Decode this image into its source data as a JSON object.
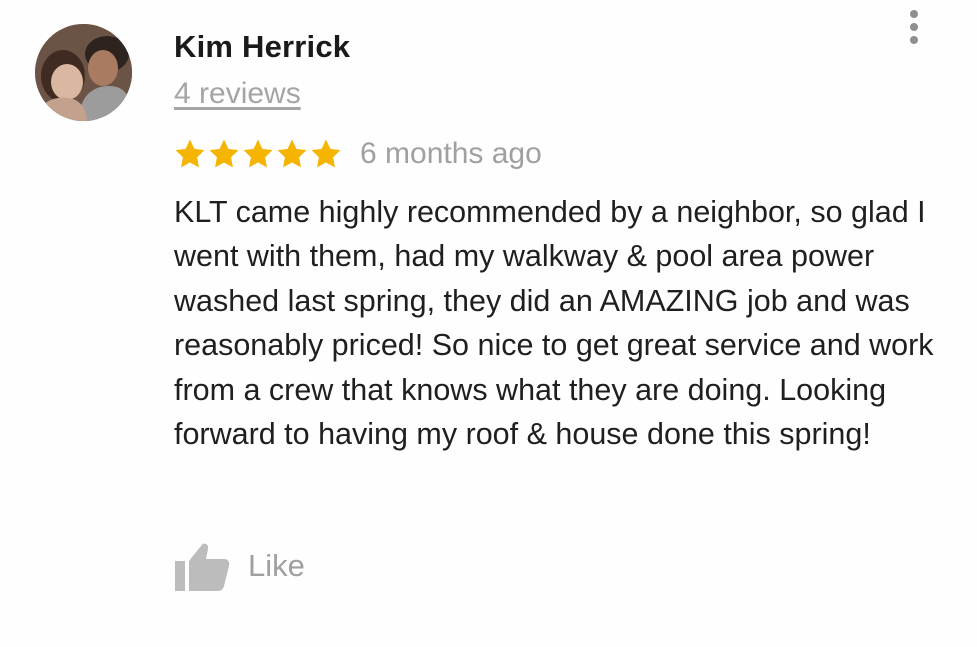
{
  "review": {
    "reviewer_name": "Kim Herrick",
    "reviews_count_label": "4 reviews",
    "rating": 5,
    "rating_max": 5,
    "time_ago": "6 months ago",
    "text": "KLT came highly recommended by a neighbor, so glad I went with them, had my walkway & pool area power washed last spring, they did an AMAZING job and was reasonably priced! So nice to get great service and work from a crew that knows what they are doing. Looking forward to having my roof & house done this spring!",
    "like_label": "Like"
  },
  "icons": {
    "avatar": "reviewer-avatar-photo",
    "more": "more-vert-icon",
    "star": "star-icon",
    "like": "thumbs-up-icon"
  },
  "colors": {
    "star": "#f4b400",
    "name": "#1a1a1a",
    "muted": "#a0a0a0",
    "body_text": "#1f1f1f",
    "icon_gray": "#bcbcbc"
  }
}
